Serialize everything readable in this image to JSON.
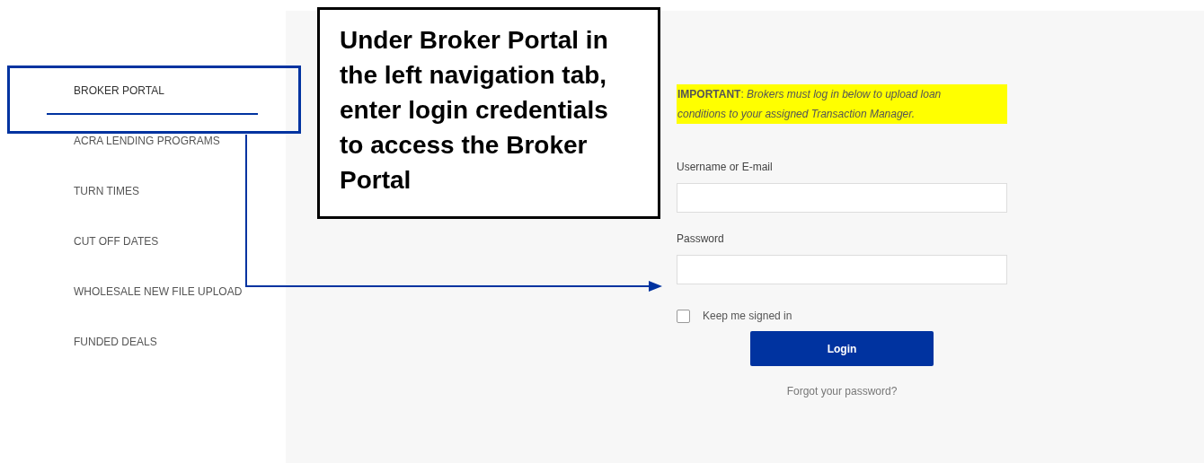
{
  "sidebar": {
    "items": [
      {
        "label": "BROKER PORTAL",
        "selected": true
      },
      {
        "label": "ACRA LENDING PROGRAMS",
        "selected": false
      },
      {
        "label": "TURN TIMES",
        "selected": false
      },
      {
        "label": "CUT OFF DATES",
        "selected": false
      },
      {
        "label": "WHOLESALE NEW FILE UPLOAD",
        "selected": false
      },
      {
        "label": "FUNDED DEALS",
        "selected": false
      }
    ]
  },
  "login": {
    "notice": "**IMPORTANT**: *Brokers must log in below to upload loan conditions to your assigned Transaction Manager.*",
    "fields": [
      {
        "label": "Username or E-mail"
      },
      {
        "label": "Password"
      }
    ],
    "remember": {
      "label": "Keep me signed in",
      "checked": false
    },
    "button": "Login",
    "forgot": "Forgot your password?"
  },
  "annotation": {
    "text": "Under Broker Portal in the left navigation tab, enter login credentials to access the Broker Portal"
  }
}
